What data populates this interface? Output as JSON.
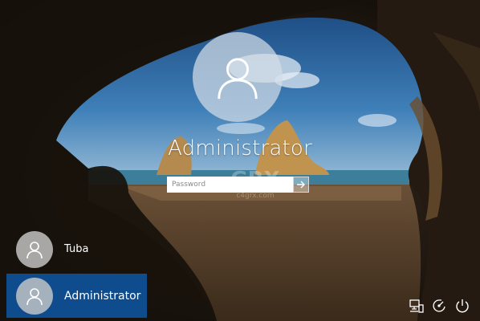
{
  "lock_screen": {
    "user_name": "Administrator",
    "password_placeholder": "Password",
    "submit_icon": "arrow-right-icon"
  },
  "watermark": {
    "text": "GRX",
    "subtext": "c4grx.com"
  },
  "user_list": [
    {
      "name": "Tuba",
      "icon": "user-icon",
      "selected": false
    },
    {
      "name": "Administrator",
      "icon": "user-icon",
      "selected": true
    }
  ],
  "system_icons": [
    "network-icon",
    "ease-of-access-icon",
    "power-icon"
  ],
  "colors": {
    "selected_user": "#0e4c8e",
    "text": "#ffffff"
  }
}
